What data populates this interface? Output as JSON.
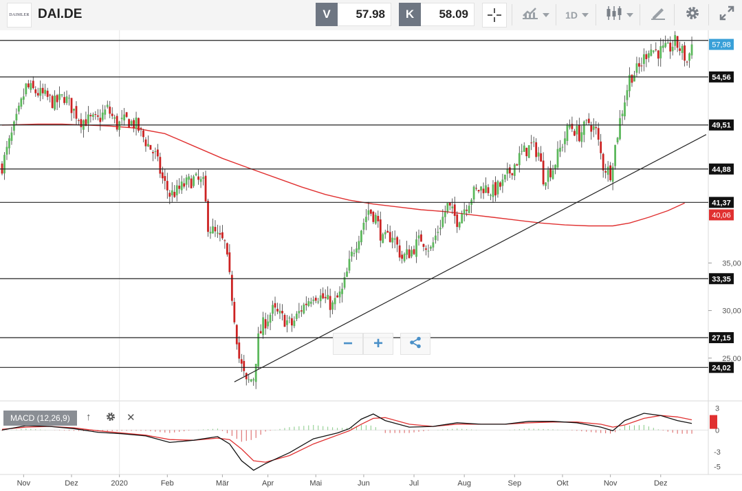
{
  "header": {
    "ticker": "DAI.DE",
    "logo_text": "DAIMLER",
    "bid_letter": "V",
    "bid_value": "57.98",
    "ask_letter": "K",
    "ask_value": "58.09",
    "timeframe": "1D",
    "icons": [
      "crosshair-icon",
      "indicator-chart-icon",
      "candlestick-icon",
      "drawing-pen-icon",
      "gear-icon",
      "fullscreen-icon"
    ]
  },
  "macd_panel": {
    "label": "MACD (12,26,9)"
  },
  "colors": {
    "up": "#5cb85c",
    "down": "#cc2222",
    "ma": "#e03030",
    "last_price_badge": "#39a0d8",
    "ma_badge": "#e03030",
    "macd": "#111111",
    "signal": "#e03030"
  },
  "chart_data": [
    {
      "type": "candlestick",
      "symbol": "DAI.DE",
      "y_axis_ticks": [
        "35,00",
        "30,00",
        "25,00"
      ],
      "y_axis_tick_values": [
        35,
        30,
        25
      ],
      "ylim": [
        20.5,
        58.6
      ],
      "x_axis_labels": [
        "Nov",
        "Dez",
        "2020",
        "Feb",
        "Mär",
        "Apr",
        "Mai",
        "Jun",
        "Jul",
        "Aug",
        "Sep",
        "Okt",
        "Nov",
        "Dez"
      ],
      "x_axis_label_index": [
        9,
        29,
        49,
        69,
        92,
        111,
        131,
        151,
        172,
        193,
        214,
        234,
        254,
        275
      ],
      "horizontal_levels": [
        {
          "value": 58.4,
          "label": ""
        },
        {
          "value": 54.56,
          "label": "54,56"
        },
        {
          "value": 49.51,
          "label": "49,51"
        },
        {
          "value": 44.88,
          "label": "44,88"
        },
        {
          "value": 41.37,
          "label": "41,37"
        },
        {
          "value": 33.35,
          "label": "33,35"
        },
        {
          "value": 27.15,
          "label": "27,15"
        },
        {
          "value": 24.02,
          "label": "24,02"
        }
      ],
      "last_price": {
        "value": 57.98,
        "label": "57,98"
      },
      "moving_average": {
        "label": "40,06",
        "last_value": 40.06,
        "points": [
          [
            0,
            49.5
          ],
          [
            15,
            49.6
          ],
          [
            25,
            49.6
          ],
          [
            45,
            49.4
          ],
          [
            55,
            49.2
          ],
          [
            68,
            48.6
          ],
          [
            80,
            47.3
          ],
          [
            92,
            46.0
          ],
          [
            105,
            44.8
          ],
          [
            115,
            43.9
          ],
          [
            125,
            43.0
          ],
          [
            135,
            42.2
          ],
          [
            145,
            41.6
          ],
          [
            155,
            41.2
          ],
          [
            165,
            40.9
          ],
          [
            175,
            40.6
          ],
          [
            185,
            40.4
          ],
          [
            195,
            40.1
          ],
          [
            205,
            39.8
          ],
          [
            215,
            39.5
          ],
          [
            225,
            39.2
          ],
          [
            235,
            39.0
          ],
          [
            245,
            38.9
          ],
          [
            255,
            38.9
          ],
          [
            262,
            39.2
          ],
          [
            270,
            39.8
          ],
          [
            278,
            40.5
          ],
          [
            285,
            41.3
          ]
        ]
      },
      "trendline": {
        "start_index": 97,
        "start_value": 22.5,
        "end_index": 294,
        "end_value": 48.5
      },
      "close_waypoints": [
        [
          0,
          45.2
        ],
        [
          6,
          50.0
        ],
        [
          10,
          53.5
        ],
        [
          14,
          53.0
        ],
        [
          18,
          52.5
        ],
        [
          22,
          51.8
        ],
        [
          26,
          52.5
        ],
        [
          30,
          51.0
        ],
        [
          33,
          50.0
        ],
        [
          40,
          50.0
        ],
        [
          44,
          51.2
        ],
        [
          48,
          49.5
        ],
        [
          52,
          50.0
        ],
        [
          56,
          49.5
        ],
        [
          60,
          47.8
        ],
        [
          64,
          46.3
        ],
        [
          67,
          43.8
        ],
        [
          70,
          42.2
        ],
        [
          73,
          42.5
        ],
        [
          76,
          43.2
        ],
        [
          80,
          43.8
        ],
        [
          84,
          43.3
        ],
        [
          86,
          39.0
        ],
        [
          90,
          37.7
        ],
        [
          93,
          37.0
        ],
        [
          96,
          31.5
        ],
        [
          99,
          25.0
        ],
        [
          102,
          22.3
        ],
        [
          105,
          23.0
        ],
        [
          107,
          27.0
        ],
        [
          109,
          28.5
        ],
        [
          113,
          30.0
        ],
        [
          117,
          29.2
        ],
        [
          121,
          28.5
        ],
        [
          125,
          30.2
        ],
        [
          130,
          31.8
        ],
        [
          134,
          31.3
        ],
        [
          138,
          30.5
        ],
        [
          142,
          32.0
        ],
        [
          146,
          35.8
        ],
        [
          150,
          38.7
        ],
        [
          153,
          40.6
        ],
        [
          156,
          39.8
        ],
        [
          159,
          37.3
        ],
        [
          163,
          38.0
        ],
        [
          167,
          35.5
        ],
        [
          171,
          36.3
        ],
        [
          175,
          37.6
        ],
        [
          179,
          36.4
        ],
        [
          182,
          38.5
        ],
        [
          186,
          41.0
        ],
        [
          190,
          39.5
        ],
        [
          193,
          40.8
        ],
        [
          197,
          42.4
        ],
        [
          201,
          43.0
        ],
        [
          205,
          42.5
        ],
        [
          209,
          43.3
        ],
        [
          213,
          45.0
        ],
        [
          217,
          46.5
        ],
        [
          221,
          47.3
        ],
        [
          224,
          46.6
        ],
        [
          226,
          44.0
        ],
        [
          230,
          45.0
        ],
        [
          234,
          47.6
        ],
        [
          237,
          49.5
        ],
        [
          241,
          48.5
        ],
        [
          245,
          49.8
        ],
        [
          248,
          48.8
        ],
        [
          251,
          45.2
        ],
        [
          254,
          44.5
        ],
        [
          258,
          50.0
        ],
        [
          262,
          54.5
        ],
        [
          266,
          55.5
        ],
        [
          270,
          57.6
        ],
        [
          274,
          57.2
        ],
        [
          278,
          57.4
        ],
        [
          281,
          58.2
        ],
        [
          284,
          57.2
        ],
        [
          286,
          56.1
        ],
        [
          288,
          57.98
        ]
      ],
      "macd": {
        "ticks": [
          "3",
          "0",
          "-3",
          "-5"
        ],
        "tick_values": [
          3,
          0,
          -3,
          -5
        ],
        "ylim": [
          -5.9,
          3.9
        ],
        "macd_line": [
          [
            0,
            0.0
          ],
          [
            10,
            0.6
          ],
          [
            20,
            0.5
          ],
          [
            30,
            0.2
          ],
          [
            40,
            -0.3
          ],
          [
            50,
            -0.5
          ],
          [
            60,
            -0.8
          ],
          [
            70,
            -1.7
          ],
          [
            80,
            -1.4
          ],
          [
            90,
            -0.9
          ],
          [
            95,
            -1.9
          ],
          [
            100,
            -4.2
          ],
          [
            105,
            -5.5
          ],
          [
            110,
            -4.6
          ],
          [
            120,
            -3.1
          ],
          [
            130,
            -1.2
          ],
          [
            140,
            -0.4
          ],
          [
            145,
            0.2
          ],
          [
            150,
            1.5
          ],
          [
            155,
            2.2
          ],
          [
            160,
            1.3
          ],
          [
            170,
            0.4
          ],
          [
            180,
            0.5
          ],
          [
            190,
            1.0
          ],
          [
            200,
            0.8
          ],
          [
            210,
            0.8
          ],
          [
            220,
            1.2
          ],
          [
            230,
            1.2
          ],
          [
            240,
            1.0
          ],
          [
            250,
            0.4
          ],
          [
            255,
            -0.1
          ],
          [
            260,
            1.3
          ],
          [
            268,
            2.3
          ],
          [
            275,
            2.0
          ],
          [
            282,
            1.3
          ],
          [
            288,
            0.9
          ]
        ],
        "signal_line": [
          [
            0,
            0.1
          ],
          [
            10,
            0.4
          ],
          [
            20,
            0.5
          ],
          [
            30,
            0.3
          ],
          [
            40,
            -0.1
          ],
          [
            50,
            -0.4
          ],
          [
            60,
            -0.7
          ],
          [
            70,
            -1.3
          ],
          [
            80,
            -1.4
          ],
          [
            90,
            -1.1
          ],
          [
            95,
            -1.3
          ],
          [
            100,
            -2.6
          ],
          [
            105,
            -4.2
          ],
          [
            110,
            -4.4
          ],
          [
            120,
            -3.5
          ],
          [
            130,
            -1.9
          ],
          [
            140,
            -0.7
          ],
          [
            145,
            -0.1
          ],
          [
            150,
            0.8
          ],
          [
            155,
            1.6
          ],
          [
            160,
            1.7
          ],
          [
            170,
            0.8
          ],
          [
            180,
            0.5
          ],
          [
            190,
            0.8
          ],
          [
            200,
            0.8
          ],
          [
            210,
            0.8
          ],
          [
            220,
            1.0
          ],
          [
            230,
            1.1
          ],
          [
            240,
            1.1
          ],
          [
            250,
            0.8
          ],
          [
            255,
            0.4
          ],
          [
            260,
            0.7
          ],
          [
            268,
            1.6
          ],
          [
            275,
            2.0
          ],
          [
            282,
            1.8
          ],
          [
            288,
            1.4
          ]
        ]
      }
    }
  ]
}
